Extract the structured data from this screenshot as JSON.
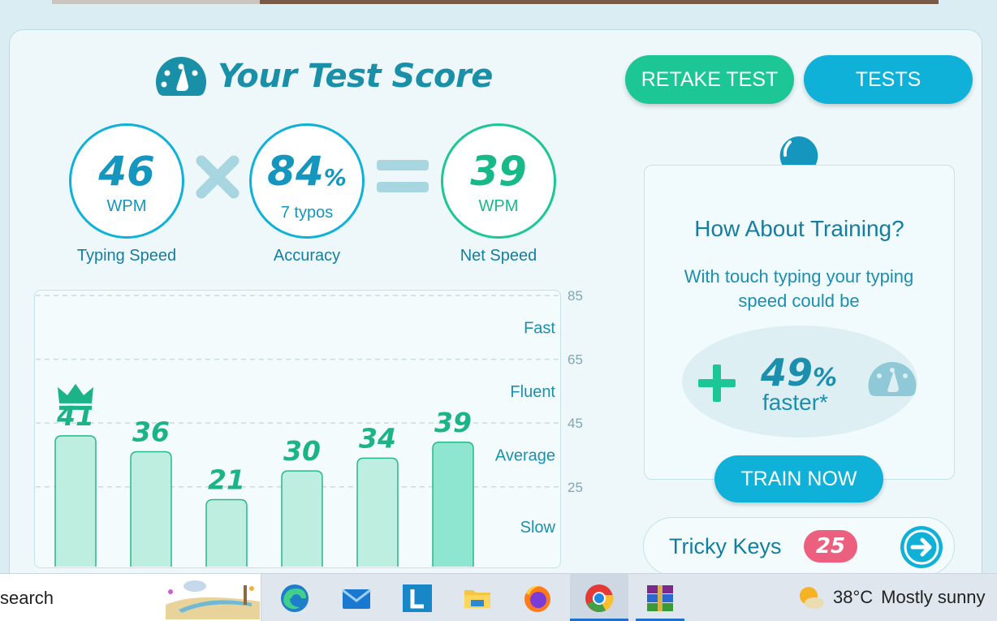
{
  "header": {
    "title": "Your Test Score",
    "retake_label": "RETAKE TEST",
    "tests_label": "TESTS"
  },
  "metrics": {
    "typing_speed": {
      "value": "46",
      "unit": "WPM",
      "label": "Typing Speed"
    },
    "accuracy": {
      "value": "84",
      "pct": "%",
      "typos": "7  typos",
      "label": "Accuracy"
    },
    "net_speed": {
      "value": "39",
      "unit": "WPM",
      "label": "Net Speed"
    }
  },
  "chart_data": {
    "type": "bar",
    "values": [
      41,
      36,
      21,
      30,
      34,
      39
    ],
    "ylim": [
      0,
      85
    ],
    "ticks": [
      "85",
      "65",
      "45",
      "25"
    ],
    "zones": [
      "Fast",
      "Fluent",
      "Average",
      "Slow"
    ],
    "best_index": 0,
    "latest_index": 5
  },
  "training": {
    "title": "How About Training?",
    "text": "With touch typing your typing speed could be",
    "plus": "+",
    "value": "49",
    "pct": "%",
    "faster": "faster*",
    "button": "TRAIN NOW"
  },
  "tricky": {
    "label": "Tricky Keys",
    "count": "25"
  },
  "taskbar": {
    "search_text": "search",
    "weather_temp": "38°C",
    "weather_text": "Mostly sunny"
  },
  "colors": {
    "accent_blue": "#0fb1d9",
    "accent_green": "#1cc795",
    "bar_fill": "#bdeee0",
    "bar_latest": "#8ee6d0",
    "bar_stroke": "#27b98a",
    "badge": "#ec5f7e"
  }
}
